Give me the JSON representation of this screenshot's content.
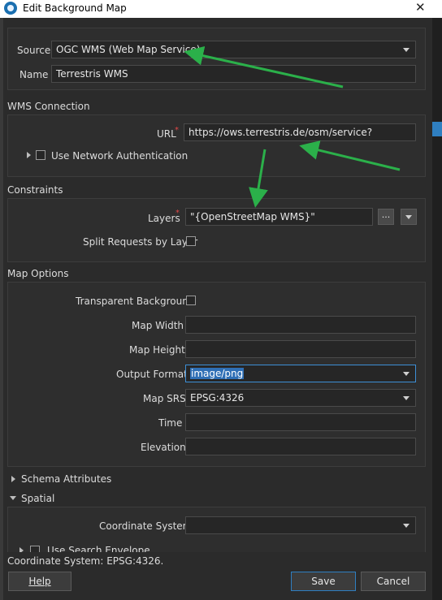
{
  "window": {
    "title": "Edit Background Map",
    "close_glyph": "✕"
  },
  "source": {
    "label": "Source",
    "value": "OGC WMS (Web Map Service)"
  },
  "name": {
    "label": "Name",
    "value": "Terrestris WMS"
  },
  "wms_connection": {
    "title": "WMS Connection",
    "url_label": "URL",
    "url_value": "https://ows.terrestris.de/osm/service?",
    "network_auth_label": "Use Network Authentication"
  },
  "constraints": {
    "title": "Constraints",
    "layers_label": "Layers",
    "layers_value": "\"{OpenStreetMap WMS}\"",
    "browse_glyph": "...",
    "split_label": "Split Requests by Layer"
  },
  "map_options": {
    "title": "Map Options",
    "transparent_label": "Transparent Background",
    "width_label": "Map Width",
    "height_label": "Map Height",
    "format_label": "Output Format",
    "format_value": "image/png",
    "srs_label": "Map SRS",
    "srs_value": "EPSG:4326",
    "time_label": "Time",
    "elevation_label": "Elevation"
  },
  "schema_attributes": {
    "title": "Schema Attributes"
  },
  "spatial": {
    "title": "Spatial",
    "coord_label": "Coordinate System",
    "coord_value": "",
    "partial_label": "Use Search Envelope"
  },
  "status": "Coordinate System: EPSG:4326.",
  "buttons": {
    "help": "Help",
    "save": "Save",
    "cancel": "Cancel"
  },
  "colors": {
    "accent": "#2f7fc1",
    "annotation_arrow": "#2bb04a",
    "required": "#e04848"
  },
  "icons": [
    "app-icon",
    "close-icon",
    "dropdown-arrow-icon",
    "expand-arrow-icon",
    "collapse-arrow-icon",
    "checkbox-icon",
    "required-asterisk-icon"
  ]
}
